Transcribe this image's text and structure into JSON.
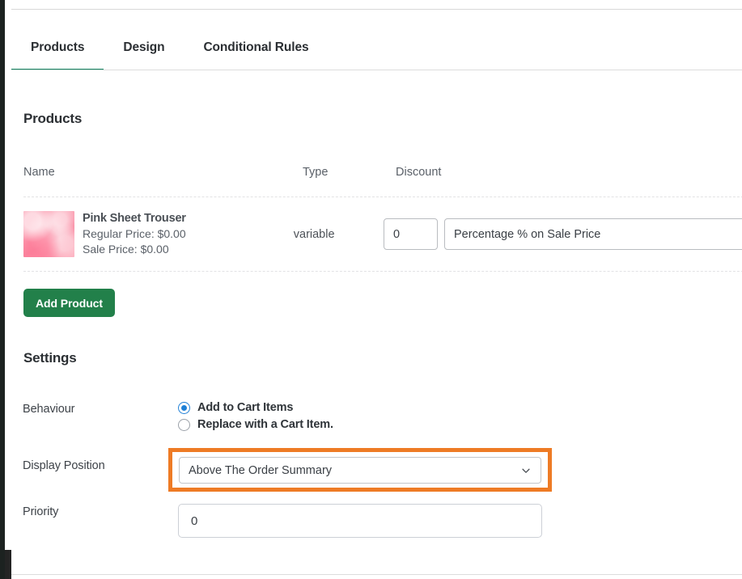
{
  "window": {
    "accent_green": "#22804a",
    "accent_teal": "#118260",
    "highlight_orange": "#ee7b25",
    "radio_blue": "#1d7fd6"
  },
  "tabs": [
    {
      "label": "Products",
      "active": true
    },
    {
      "label": "Design",
      "active": false
    },
    {
      "label": "Conditional Rules",
      "active": false
    }
  ],
  "products_section": {
    "title": "Products",
    "columns": [
      "Name",
      "Type",
      "Discount"
    ],
    "rows": [
      {
        "thumbnail": "pink-fabric-thumbnail",
        "name": "Pink Sheet Trouser",
        "regular_price": "Regular Price: $0.00",
        "sale_price": "Sale Price: $0.00",
        "type": "variable",
        "discount_value": "0",
        "discount_mode": "Percentage % on Sale Price"
      }
    ],
    "add_product_label": "Add Product"
  },
  "settings_section": {
    "title": "Settings",
    "behaviour": {
      "label": "Behaviour",
      "options": [
        {
          "label": "Add to Cart Items",
          "selected": true
        },
        {
          "label": "Replace with a Cart Item.",
          "selected": false
        }
      ]
    },
    "display_position": {
      "label": "Display Position",
      "value": "Above The Order Summary",
      "chevron": "chevron-down-icon"
    },
    "priority": {
      "label": "Priority",
      "value": "0"
    }
  }
}
